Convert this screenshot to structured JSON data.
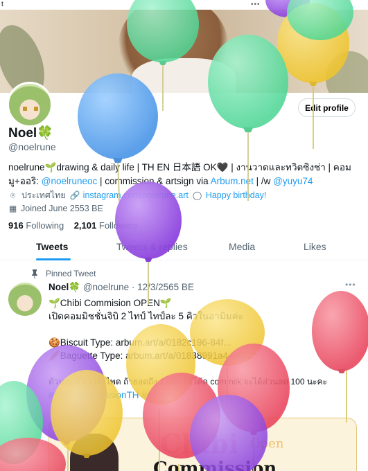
{
  "status_bar": {
    "left": "t",
    "dots": "•••"
  },
  "profile": {
    "name": "Noel",
    "name_emoji": "🍀",
    "handle": "@noelrune",
    "edit_button": "Edit profile",
    "bio": {
      "part1": "noelrune🌱drawing & daily life | TH EN 日本語 OK🖤 | งานวาดและทวิตซิงช่า | คอมมู+ออริ: ",
      "link1": "@noelruneoc",
      "part2": " | commission & artsign via ",
      "link2": "Arbum.net",
      "part3": " | /w ",
      "link3": "@yuyu74"
    },
    "location": "ประเทศไทย",
    "website": "instagram.com/noelrune.art",
    "birthday": "Happy birthday!",
    "joined": "Joined June 2553 BE",
    "following_count": "916",
    "following_label": "Following",
    "followers_count": "2,101",
    "followers_label": "Followers"
  },
  "tabs": [
    "Tweets",
    "Tweets & replies",
    "Media",
    "Likes"
  ],
  "pinned_tweet": {
    "label": "Pinned Tweet",
    "author_name": "Noel",
    "author_emoji": "🍀",
    "handle": "@noelrune",
    "date": "12/3/2565 BE",
    "lines": [
      "🌱Chibi Commision OPEN🌱",
      "เปิดคอมมิชชั่นจิบิ 2 ไทป์ ไทป์ละ 5 คิวในอามิมค่ะ",
      "",
      "🍪Biscuit Type: arbum.art/a/0182c196-84f...",
      "🥖Baguette Type: arbum.art/a/01838991a4-ef0...",
      "",
      "ต้วนลุกค้าเราจะไพด ถ้ายอดถึง 1,000 ใช้โค้ด cornmilk จะได้ส่วนลด 100 นะคะ",
      "#ChibiCommissionTH #arbum"
    ],
    "card": {
      "title1": "Chibi",
      "title2": "Open",
      "title3": "Commission"
    }
  },
  "balloon_colors": {
    "blue": "#5aa6ee",
    "green": "#5ee0a4",
    "purple": "#9b54e6",
    "yellow": "#f2cf45",
    "red": "#ef5a6e"
  }
}
